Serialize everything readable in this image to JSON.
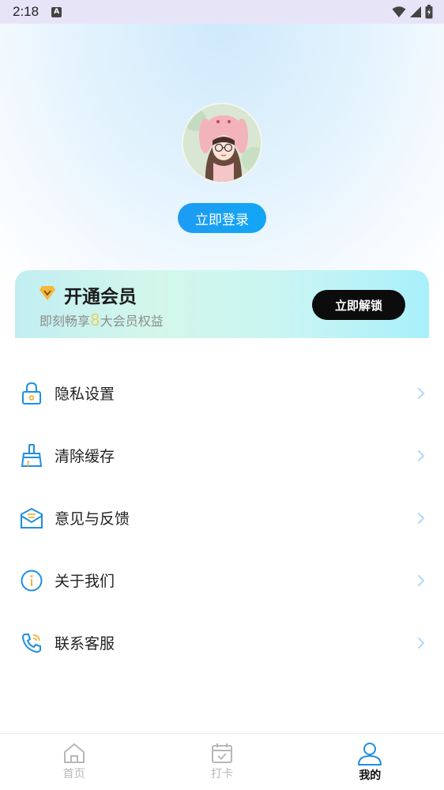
{
  "status_bar": {
    "time": "2:18",
    "indicator": "A"
  },
  "profile": {
    "login_label": "立即登录"
  },
  "vip": {
    "title": "开通会员",
    "subtitle_prefix": "即刻畅享",
    "subtitle_number": "8",
    "subtitle_suffix": "大会员权益",
    "unlock_label": "立即解锁",
    "colors": {
      "accent_number": "#e6d36a",
      "button": "#0c0c0c"
    }
  },
  "menu": {
    "items": [
      {
        "label": "隐私设置",
        "icon": "lock-icon"
      },
      {
        "label": "清除缓存",
        "icon": "broom-icon"
      },
      {
        "label": "意见与反馈",
        "icon": "mail-icon"
      },
      {
        "label": "关于我们",
        "icon": "info-icon"
      },
      {
        "label": "联系客服",
        "icon": "phone-icon"
      }
    ]
  },
  "tab_bar": {
    "tabs": [
      {
        "label": "首页",
        "icon": "home-icon",
        "active": false
      },
      {
        "label": "打卡",
        "icon": "calendar-check-icon",
        "active": false
      },
      {
        "label": "我的",
        "icon": "user-icon",
        "active": true
      }
    ]
  },
  "colors": {
    "primary": "#1e9bf4",
    "icon_blue": "#1f8fe0",
    "chevron": "#b8d9f2"
  }
}
